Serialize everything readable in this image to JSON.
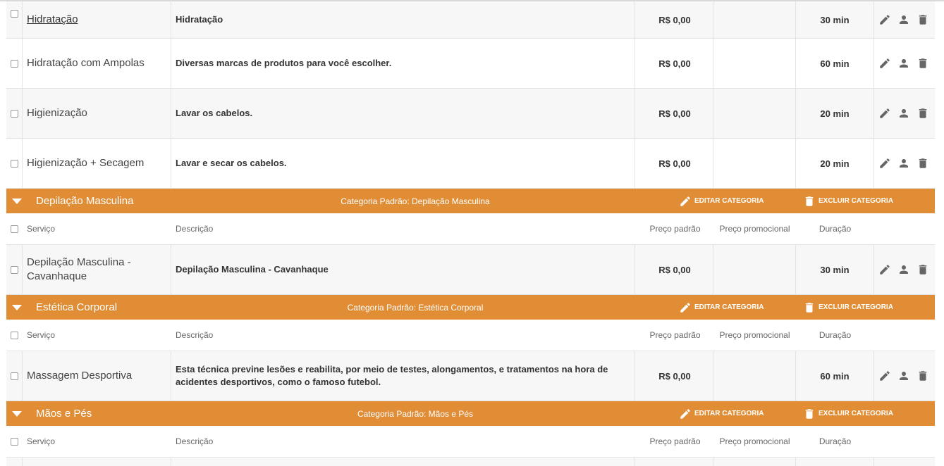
{
  "columns": {
    "service": "Serviço",
    "description": "Descrição",
    "price": "Preço padrão",
    "promo": "Preço promocional",
    "duration": "Duração"
  },
  "top_rows": [
    {
      "name": "Hidratação",
      "description": "Hidratação",
      "price": "R$ 0,00",
      "promo": "",
      "duration": "30 min",
      "linked": true
    },
    {
      "name": "Hidratação com Ampolas",
      "description": "Diversas marcas de produtos para você escolher.",
      "price": "R$ 0,00",
      "promo": "",
      "duration": "60 min"
    },
    {
      "name": "Higienização",
      "description": "Lavar os cabelos.",
      "price": "R$ 0,00",
      "promo": "",
      "duration": "20 min"
    },
    {
      "name": "Higienização + Secagem",
      "description": "Lavar e secar os cabelos.",
      "price": "R$ 0,00",
      "promo": "",
      "duration": "20 min"
    }
  ],
  "categories": [
    {
      "name": "Depilação Masculina",
      "default_label": "Categoria Padrão: Depilação Masculina",
      "edit_label": "EDITAR CATEGORIA",
      "delete_label": "EXCLUIR CATEGORIA",
      "rows": [
        {
          "name": "Depilação Masculina - Cavanhaque",
          "description": "Depilação Masculina - Cavanhaque",
          "price": "R$ 0,00",
          "promo": "",
          "duration": "30 min"
        }
      ]
    },
    {
      "name": "Estética Corporal",
      "default_label": "Categoria Padrão: Estética Corporal",
      "edit_label": "EDITAR CATEGORIA",
      "delete_label": "EXCLUIR CATEGORIA",
      "rows": [
        {
          "name": "Massagem Desportiva",
          "description": "Esta técnica previne lesões e reabilita, por meio de testes, alongamentos, e tratamentos na hora de acidentes desportivos, como o famoso futebol.",
          "price": "R$ 0,00",
          "promo": "",
          "duration": "60 min"
        }
      ]
    },
    {
      "name": "Mãos e Pés",
      "default_label": "Categoria Padrão: Mãos e Pés",
      "edit_label": "EDITAR CATEGORIA",
      "delete_label": "EXCLUIR CATEGORIA",
      "rows": []
    }
  ],
  "icons": {
    "edit": "pencil-icon",
    "professionals": "user-icon",
    "delete": "trash-icon",
    "collapse": "caret-down-icon"
  },
  "colors": {
    "category_bar": "#e18d35",
    "icon": "#666666"
  }
}
